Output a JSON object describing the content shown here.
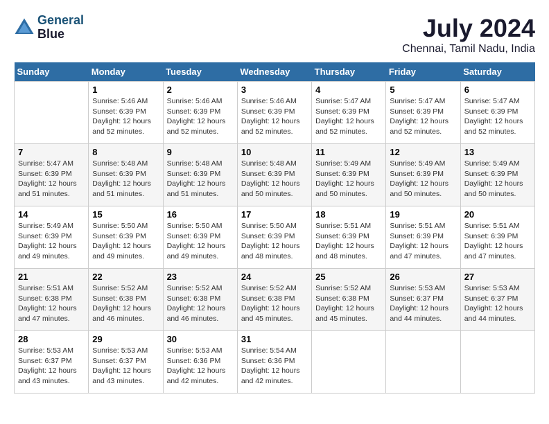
{
  "header": {
    "logo_line1": "General",
    "logo_line2": "Blue",
    "month": "July 2024",
    "location": "Chennai, Tamil Nadu, India"
  },
  "columns": [
    "Sunday",
    "Monday",
    "Tuesday",
    "Wednesday",
    "Thursday",
    "Friday",
    "Saturday"
  ],
  "weeks": [
    [
      {
        "day": "",
        "info": ""
      },
      {
        "day": "1",
        "info": "Sunrise: 5:46 AM\nSunset: 6:39 PM\nDaylight: 12 hours\nand 52 minutes."
      },
      {
        "day": "2",
        "info": "Sunrise: 5:46 AM\nSunset: 6:39 PM\nDaylight: 12 hours\nand 52 minutes."
      },
      {
        "day": "3",
        "info": "Sunrise: 5:46 AM\nSunset: 6:39 PM\nDaylight: 12 hours\nand 52 minutes."
      },
      {
        "day": "4",
        "info": "Sunrise: 5:47 AM\nSunset: 6:39 PM\nDaylight: 12 hours\nand 52 minutes."
      },
      {
        "day": "5",
        "info": "Sunrise: 5:47 AM\nSunset: 6:39 PM\nDaylight: 12 hours\nand 52 minutes."
      },
      {
        "day": "6",
        "info": "Sunrise: 5:47 AM\nSunset: 6:39 PM\nDaylight: 12 hours\nand 52 minutes."
      }
    ],
    [
      {
        "day": "7",
        "info": "Sunrise: 5:47 AM\nSunset: 6:39 PM\nDaylight: 12 hours\nand 51 minutes."
      },
      {
        "day": "8",
        "info": "Sunrise: 5:48 AM\nSunset: 6:39 PM\nDaylight: 12 hours\nand 51 minutes."
      },
      {
        "day": "9",
        "info": "Sunrise: 5:48 AM\nSunset: 6:39 PM\nDaylight: 12 hours\nand 51 minutes."
      },
      {
        "day": "10",
        "info": "Sunrise: 5:48 AM\nSunset: 6:39 PM\nDaylight: 12 hours\nand 50 minutes."
      },
      {
        "day": "11",
        "info": "Sunrise: 5:49 AM\nSunset: 6:39 PM\nDaylight: 12 hours\nand 50 minutes."
      },
      {
        "day": "12",
        "info": "Sunrise: 5:49 AM\nSunset: 6:39 PM\nDaylight: 12 hours\nand 50 minutes."
      },
      {
        "day": "13",
        "info": "Sunrise: 5:49 AM\nSunset: 6:39 PM\nDaylight: 12 hours\nand 50 minutes."
      }
    ],
    [
      {
        "day": "14",
        "info": "Sunrise: 5:49 AM\nSunset: 6:39 PM\nDaylight: 12 hours\nand 49 minutes."
      },
      {
        "day": "15",
        "info": "Sunrise: 5:50 AM\nSunset: 6:39 PM\nDaylight: 12 hours\nand 49 minutes."
      },
      {
        "day": "16",
        "info": "Sunrise: 5:50 AM\nSunset: 6:39 PM\nDaylight: 12 hours\nand 49 minutes."
      },
      {
        "day": "17",
        "info": "Sunrise: 5:50 AM\nSunset: 6:39 PM\nDaylight: 12 hours\nand 48 minutes."
      },
      {
        "day": "18",
        "info": "Sunrise: 5:51 AM\nSunset: 6:39 PM\nDaylight: 12 hours\nand 48 minutes."
      },
      {
        "day": "19",
        "info": "Sunrise: 5:51 AM\nSunset: 6:39 PM\nDaylight: 12 hours\nand 47 minutes."
      },
      {
        "day": "20",
        "info": "Sunrise: 5:51 AM\nSunset: 6:39 PM\nDaylight: 12 hours\nand 47 minutes."
      }
    ],
    [
      {
        "day": "21",
        "info": "Sunrise: 5:51 AM\nSunset: 6:38 PM\nDaylight: 12 hours\nand 47 minutes."
      },
      {
        "day": "22",
        "info": "Sunrise: 5:52 AM\nSunset: 6:38 PM\nDaylight: 12 hours\nand 46 minutes."
      },
      {
        "day": "23",
        "info": "Sunrise: 5:52 AM\nSunset: 6:38 PM\nDaylight: 12 hours\nand 46 minutes."
      },
      {
        "day": "24",
        "info": "Sunrise: 5:52 AM\nSunset: 6:38 PM\nDaylight: 12 hours\nand 45 minutes."
      },
      {
        "day": "25",
        "info": "Sunrise: 5:52 AM\nSunset: 6:38 PM\nDaylight: 12 hours\nand 45 minutes."
      },
      {
        "day": "26",
        "info": "Sunrise: 5:53 AM\nSunset: 6:37 PM\nDaylight: 12 hours\nand 44 minutes."
      },
      {
        "day": "27",
        "info": "Sunrise: 5:53 AM\nSunset: 6:37 PM\nDaylight: 12 hours\nand 44 minutes."
      }
    ],
    [
      {
        "day": "28",
        "info": "Sunrise: 5:53 AM\nSunset: 6:37 PM\nDaylight: 12 hours\nand 43 minutes."
      },
      {
        "day": "29",
        "info": "Sunrise: 5:53 AM\nSunset: 6:37 PM\nDaylight: 12 hours\nand 43 minutes."
      },
      {
        "day": "30",
        "info": "Sunrise: 5:53 AM\nSunset: 6:36 PM\nDaylight: 12 hours\nand 42 minutes."
      },
      {
        "day": "31",
        "info": "Sunrise: 5:54 AM\nSunset: 6:36 PM\nDaylight: 12 hours\nand 42 minutes."
      },
      {
        "day": "",
        "info": ""
      },
      {
        "day": "",
        "info": ""
      },
      {
        "day": "",
        "info": ""
      }
    ]
  ]
}
